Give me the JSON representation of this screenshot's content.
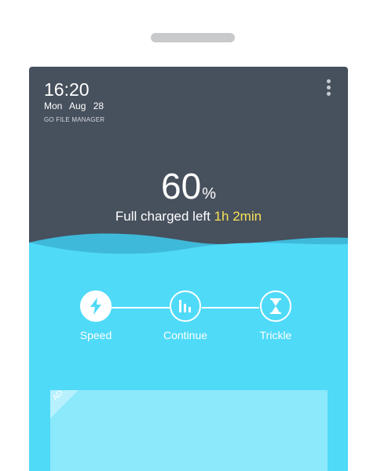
{
  "status": {
    "time": "16:20",
    "weekday": "Mon",
    "month": "Aug",
    "day": "28",
    "app_name": "GO FILE MANAGER"
  },
  "battery": {
    "percent": "60",
    "unit": "%",
    "charge_label": "Full charged left",
    "time_left": "1h 2min"
  },
  "modes": [
    {
      "label": "Speed",
      "icon": "lightning-icon",
      "active": true
    },
    {
      "label": "Continue",
      "icon": "bars-icon",
      "active": false
    },
    {
      "label": "Trickle",
      "icon": "hourglass-icon",
      "active": false
    }
  ],
  "ad": {
    "tag": "AD"
  },
  "colors": {
    "header_bg": "#47505d",
    "water": "#4fdaf8",
    "accent_time": "#f7e25a",
    "ad_panel": "#8ce8fb"
  }
}
